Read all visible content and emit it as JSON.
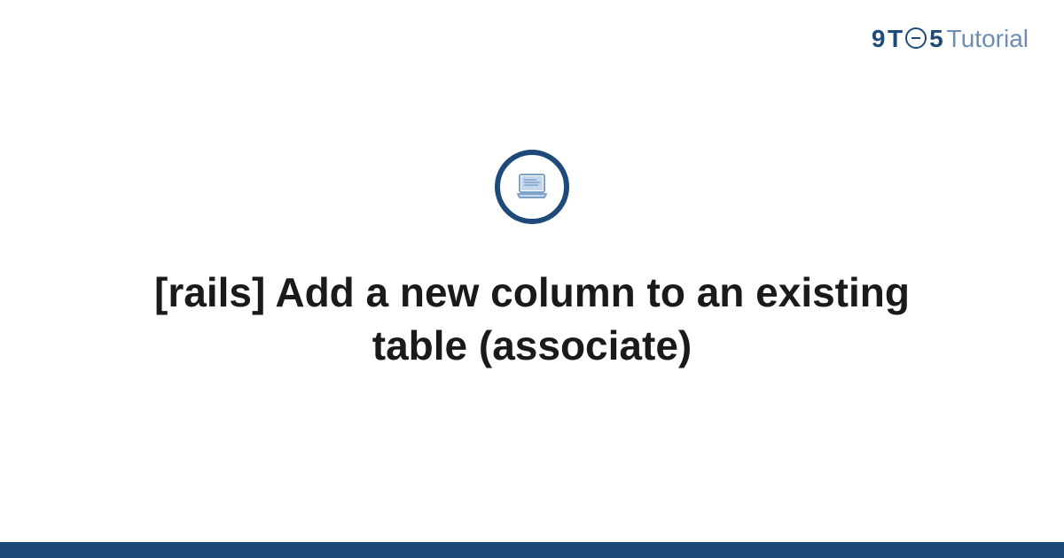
{
  "brand": {
    "part1": "9",
    "part2": "T",
    "circle_glyph": "⊖",
    "part3": "5",
    "suffix": "Tutorial"
  },
  "icon": "laptop-icon",
  "title": "[rails] Add a new column to an existing table (associate)",
  "colors": {
    "primary": "#1e4a7a",
    "accent": "#6b8fb3",
    "icon_fill": "#c4d7ed"
  }
}
